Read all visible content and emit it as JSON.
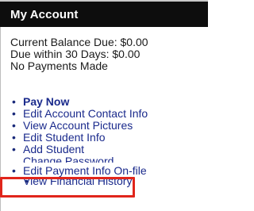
{
  "panel": {
    "title": "My Account"
  },
  "summary": {
    "balance_due": "Current Balance Due: $0.00",
    "due_30_days": "Due within 30 Days: $0.00",
    "payments": "No Payments Made"
  },
  "links": [
    {
      "label": "Pay Now",
      "bold": true
    },
    {
      "label": "Edit Account Contact Info"
    },
    {
      "label": "View Account Pictures"
    },
    {
      "label": "Edit Student Info"
    },
    {
      "label": "Add Student"
    },
    {
      "label": "Change Password"
    },
    {
      "label": "Edit Payment Info On-file"
    },
    {
      "label": "View Financial History"
    }
  ],
  "colors": {
    "header_bg": "#0d0d0d",
    "link": "#1a2a8c",
    "highlight": "#e0251b"
  }
}
